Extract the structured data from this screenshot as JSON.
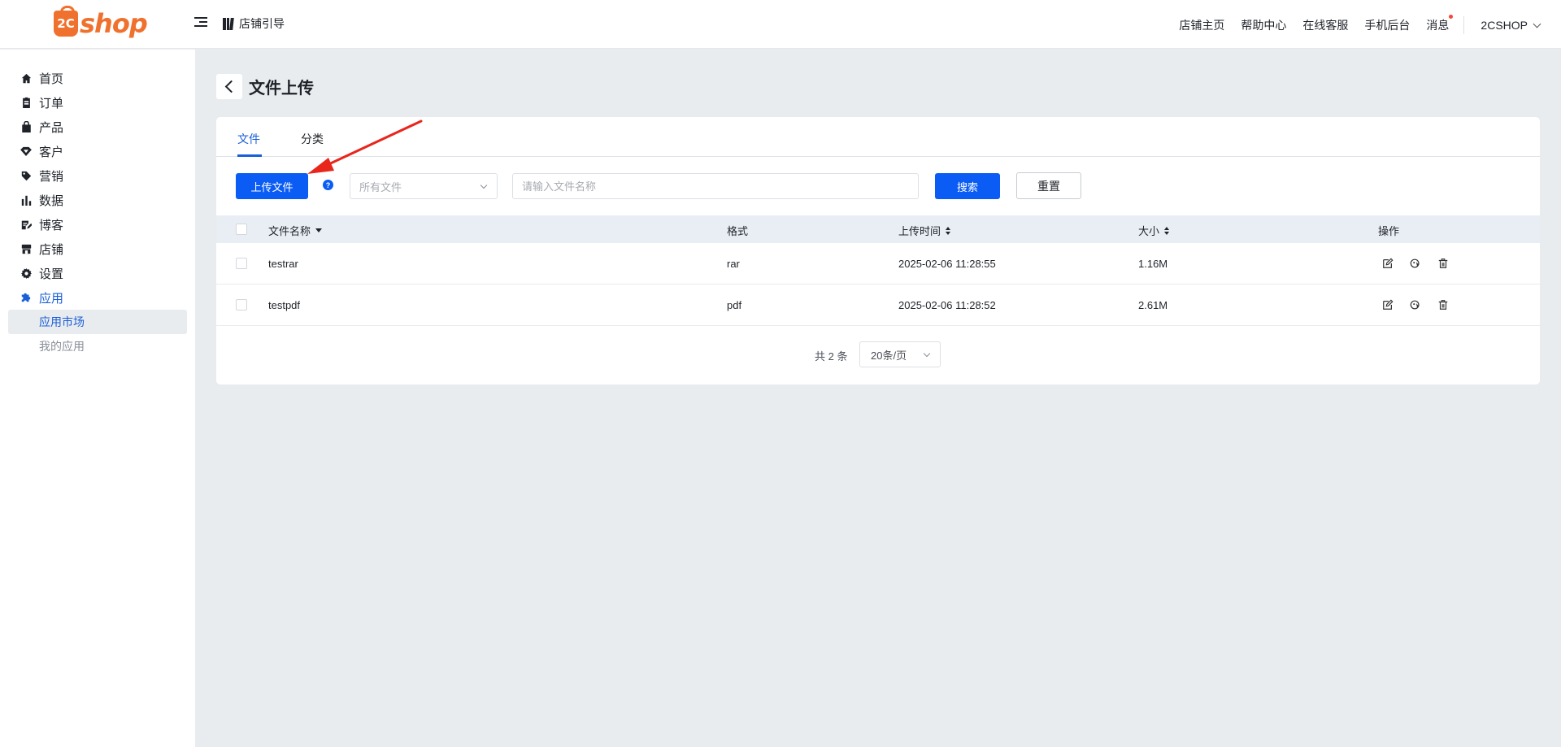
{
  "header": {
    "logo_text": "shop",
    "logo_mark": "2C",
    "guide_label": "店铺引导",
    "nav": [
      "店铺主页",
      "帮助中心",
      "在线客服",
      "手机后台",
      "消息"
    ],
    "user": "2CSHOP"
  },
  "sidebar": {
    "items": [
      {
        "label": "首页",
        "icon": "home-icon"
      },
      {
        "label": "订单",
        "icon": "clipboard-icon"
      },
      {
        "label": "产品",
        "icon": "bag-icon"
      },
      {
        "label": "客户",
        "icon": "diamond-icon"
      },
      {
        "label": "营销",
        "icon": "tag-icon"
      },
      {
        "label": "数据",
        "icon": "bar-chart-icon"
      },
      {
        "label": "博客",
        "icon": "edit-doc-icon"
      },
      {
        "label": "店铺",
        "icon": "store-icon"
      },
      {
        "label": "设置",
        "icon": "gear-icon"
      },
      {
        "label": "应用",
        "icon": "puzzle-icon"
      }
    ],
    "sub_items": [
      "应用市场",
      "我的应用"
    ]
  },
  "page": {
    "title": "文件上传"
  },
  "tabs": [
    "文件",
    "分类"
  ],
  "toolbar": {
    "upload_label": "上传文件",
    "help": "?",
    "category_placeholder": "所有文件",
    "search_placeholder": "请输入文件名称",
    "search_label": "搜索",
    "reset_label": "重置"
  },
  "table": {
    "columns": [
      "文件名称",
      "格式",
      "上传时间",
      "大小",
      "操作"
    ],
    "rows": [
      {
        "name": "testrar",
        "format": "rar",
        "time": "2025-02-06 11:28:55",
        "size": "1.16M"
      },
      {
        "name": "testpdf",
        "format": "pdf",
        "time": "2025-02-06 11:28:52",
        "size": "2.61M"
      }
    ]
  },
  "pagination": {
    "total": "共 2 条",
    "page_size": "20条/页"
  },
  "colors": {
    "primary": "#0a5cf5",
    "brand": "#f0712e",
    "active_link": "#1a5fd8",
    "annotation": "#e8261c"
  }
}
